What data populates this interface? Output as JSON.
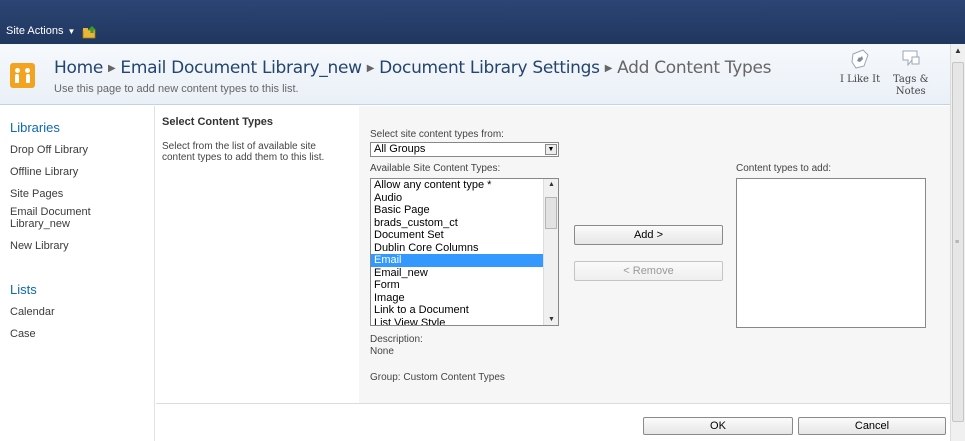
{
  "ribbon": {
    "site_actions": "Site Actions"
  },
  "header": {
    "breadcrumb": [
      "Home",
      "Email Document Library_new",
      "Document Library Settings"
    ],
    "current": "Add Content Types",
    "subtitle": "Use this page to add new content types to this list.",
    "like_label": "I Like It",
    "tags_label_1": "Tags &",
    "tags_label_2": "Notes"
  },
  "leftnav": {
    "libraries_heading": "Libraries",
    "libraries": [
      "Drop Off Library",
      "Offline Library",
      "Site Pages",
      "Email Document",
      "Library_new",
      "New Library"
    ],
    "lists_heading": "Lists",
    "lists": [
      "Calendar",
      "Case"
    ]
  },
  "section": {
    "title": "Select Content Types",
    "description": "Select from the list of available site content types to add them to this list."
  },
  "form": {
    "select_from_label": "Select site content types from:",
    "select_from_value": "All Groups",
    "available_label": "Available Site Content Types:",
    "available_items": [
      "Allow any content type *",
      "Audio",
      "Basic Page",
      "brads_custom_ct",
      "Document Set",
      "Dublin Core Columns",
      "Email",
      "Email_new",
      "Form",
      "Image",
      "Link to a Document",
      "List View Style"
    ],
    "selected_item": "Email",
    "add_button": "Add >",
    "remove_button": "< Remove",
    "to_add_label": "Content types to add:",
    "description_label": "Description:",
    "description_value": "None",
    "group_text": "Group: Custom Content Types"
  },
  "actions": {
    "ok": "OK",
    "cancel": "Cancel"
  },
  "colors": {
    "ribbon": "#2b4574",
    "link": "#0b6ab0",
    "selection": "#3399ff",
    "title": "#23456e"
  }
}
